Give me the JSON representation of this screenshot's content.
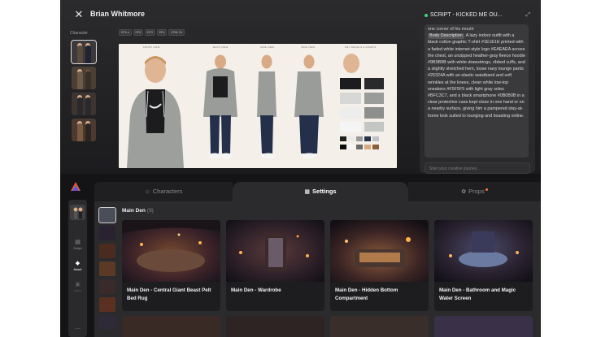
{
  "header": {
    "close_icon": "close-icon",
    "character_name": "Brian Whitmore",
    "character_section_label": "Character",
    "chips": [
      "EP6 a",
      "EP8",
      "EP3",
      "EP4",
      "EP6b 2b"
    ]
  },
  "sheet": {
    "captions": [
      "FRONT VIEW",
      "BACK VIEW",
      "SIDE VIEW",
      "SIDE VIEW",
      "KEY DETAILS & ASSETS"
    ]
  },
  "chat": {
    "title": "SCRIPT - KICKED ME OU...",
    "top_line": "one corner of his mouth",
    "body_tag": "Body Description",
    "body_text": "A lazy indoor outfit with a black cotton graphic T-shirt #1E1E1E printed with a faded white internet-style logo #EAEAEA across the chest, an unzipped heather-gray fleece hoodie #9B9B9B with white drawstrings, ribbed cuffs, and a slightly stretched hem, loose navy lounge pants #25324A with an elastic waistband and soft wrinkles at the knees, clean white low-top sneakers #F5F5F5 with light gray soles #BFC3C7, and a black smartphone #0B0B0B in a clear protective case kept close in one hand or on a nearby surface, giving him a pampered stay-at-home look suited to lounging and boasting online.",
    "input_placeholder": "Start your creative journey...",
    "status_color": "#3fd47a"
  },
  "sidebar": {
    "items": [
      {
        "label": "Script",
        "icon": "document-icon",
        "state": "normal"
      },
      {
        "label": "Asset",
        "icon": "diamond-icon",
        "state": "active"
      },
      {
        "label": "Video",
        "icon": "film-icon",
        "state": "dim"
      }
    ]
  },
  "tabs": [
    {
      "label": "Characters",
      "icon": "characters-icon"
    },
    {
      "label": "Settings",
      "icon": "settings-icon"
    },
    {
      "label": "Props",
      "icon": "props-icon"
    }
  ],
  "section": {
    "title": "Main Den",
    "count": "(9)"
  },
  "cards": [
    {
      "label": "Main Den - Central Giant Beast Pelt Bed Rug"
    },
    {
      "label": "Main Den - Wardrobe"
    },
    {
      "label": "Main Den - Hidden Bottom Compartment"
    },
    {
      "label": "Main Den - Bathroom and Magic Water Screen"
    }
  ],
  "colors": {
    "app_bg": "#141416",
    "panel": "#2b2b2d",
    "accent_props_dot": "#ff7a3c"
  }
}
